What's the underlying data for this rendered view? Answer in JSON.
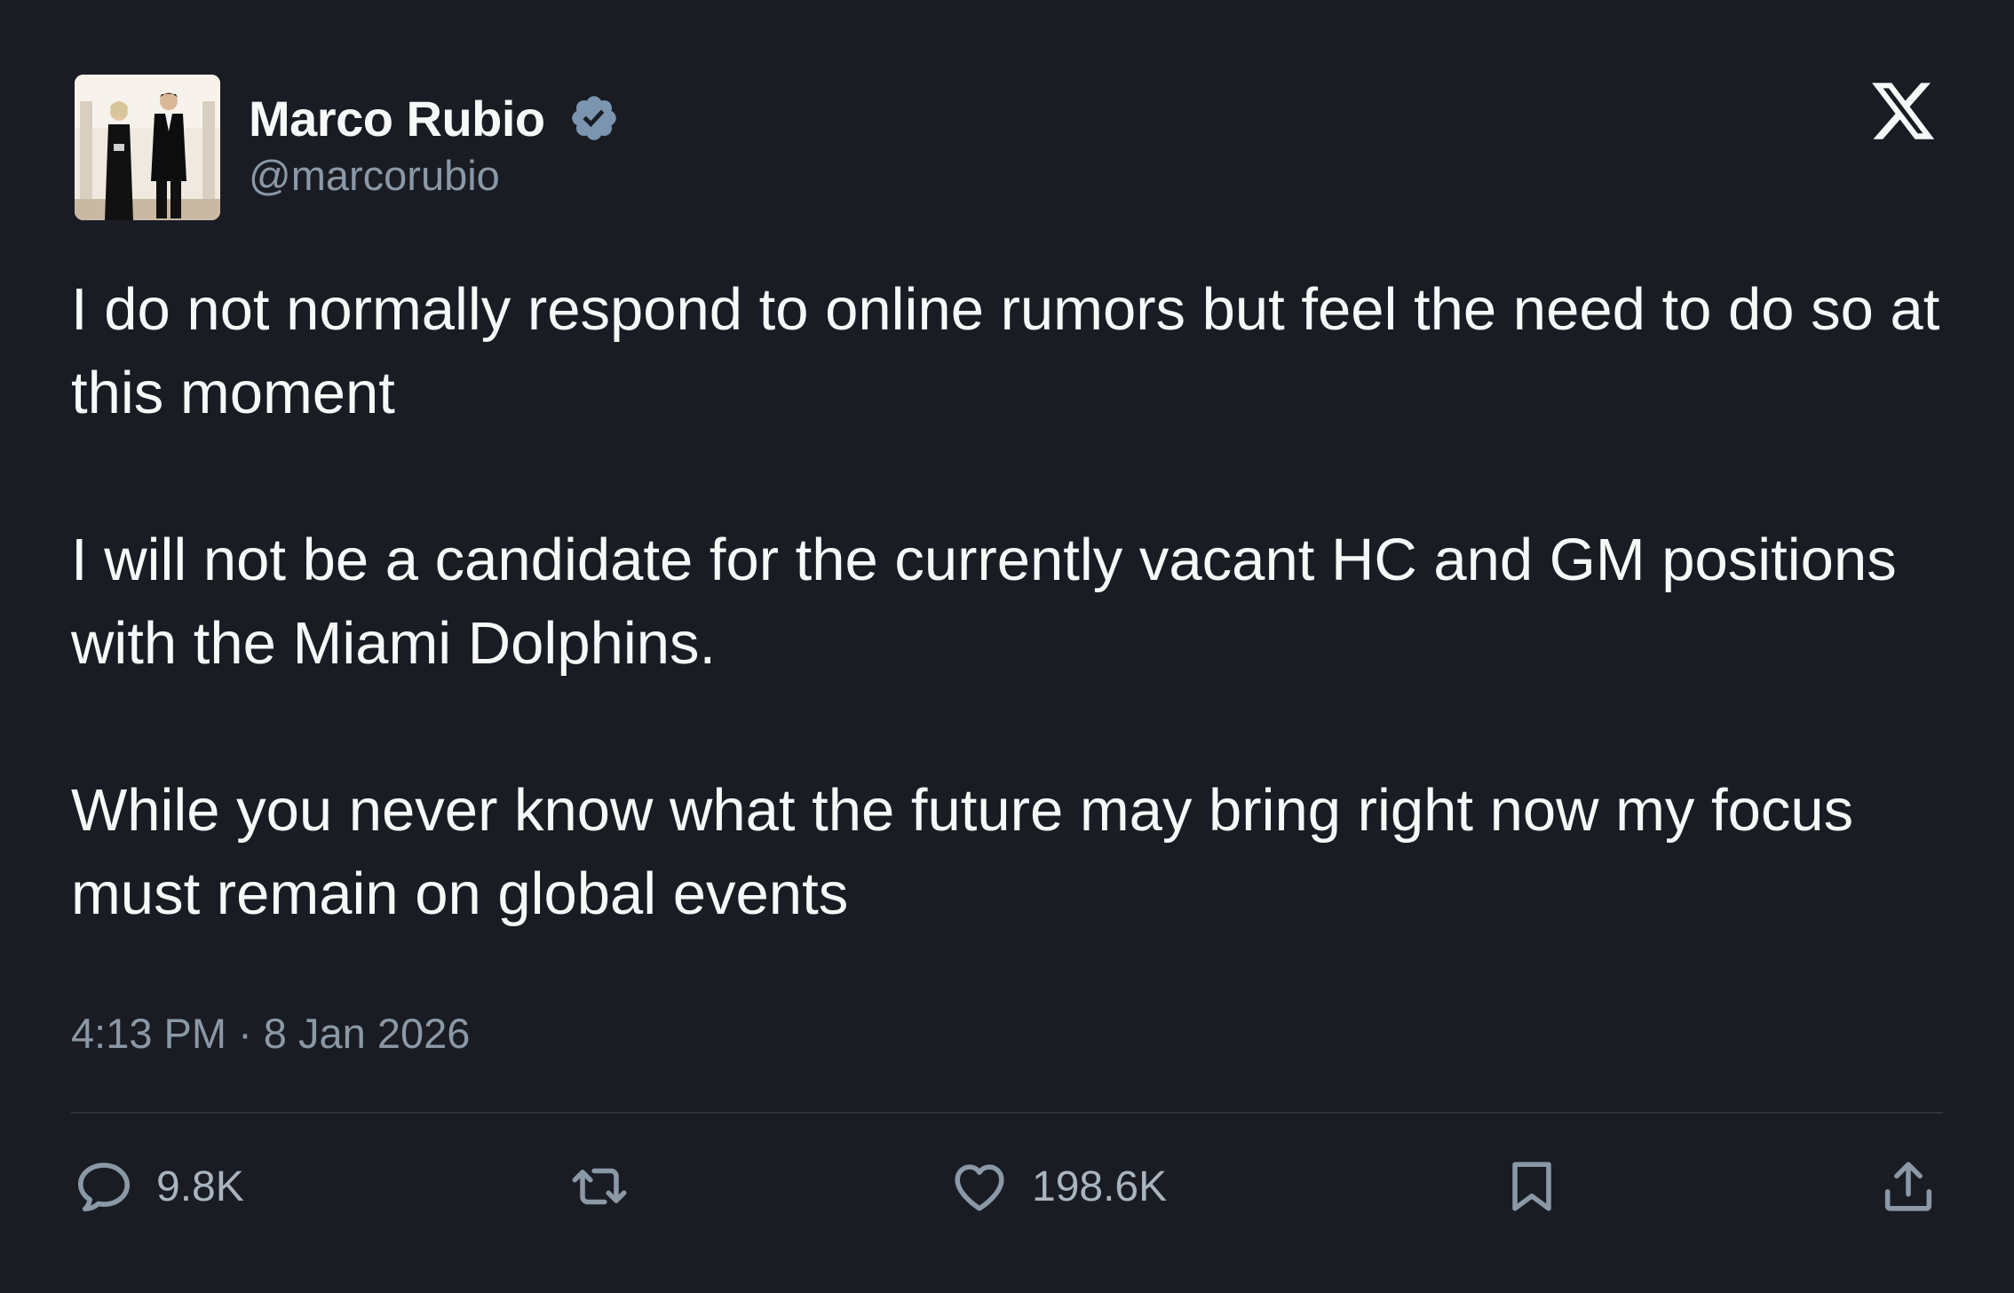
{
  "author": {
    "display_name": "Marco Rubio",
    "handle": "@marcorubio",
    "verified": true,
    "verified_icon": "verified-badge-icon",
    "verified_color": "#7b95b0"
  },
  "brand": {
    "icon": "x-logo-icon"
  },
  "post": {
    "paragraphs": [
      "I do not normally respond to online rumors but feel the need to do so at this moment",
      "I will not be a candidate for the currently vacant HC and GM positions with the Miami Dolphins.",
      "While you never know what the future may bring right now my focus must remain on global events"
    ],
    "timestamp": "4:13 PM · 8 Jan 2026"
  },
  "actions": {
    "reply": {
      "icon": "reply-icon",
      "count": "9.8K"
    },
    "retweet": {
      "icon": "retweet-icon"
    },
    "like": {
      "icon": "heart-icon",
      "count": "198.6K"
    },
    "bookmark": {
      "icon": "bookmark-icon"
    },
    "share": {
      "icon": "share-icon"
    }
  },
  "colors": {
    "background": "#1a1c24",
    "text_primary": "#f7f9f9",
    "text_secondary": "#8b98a5",
    "divider": "#2f3336"
  }
}
